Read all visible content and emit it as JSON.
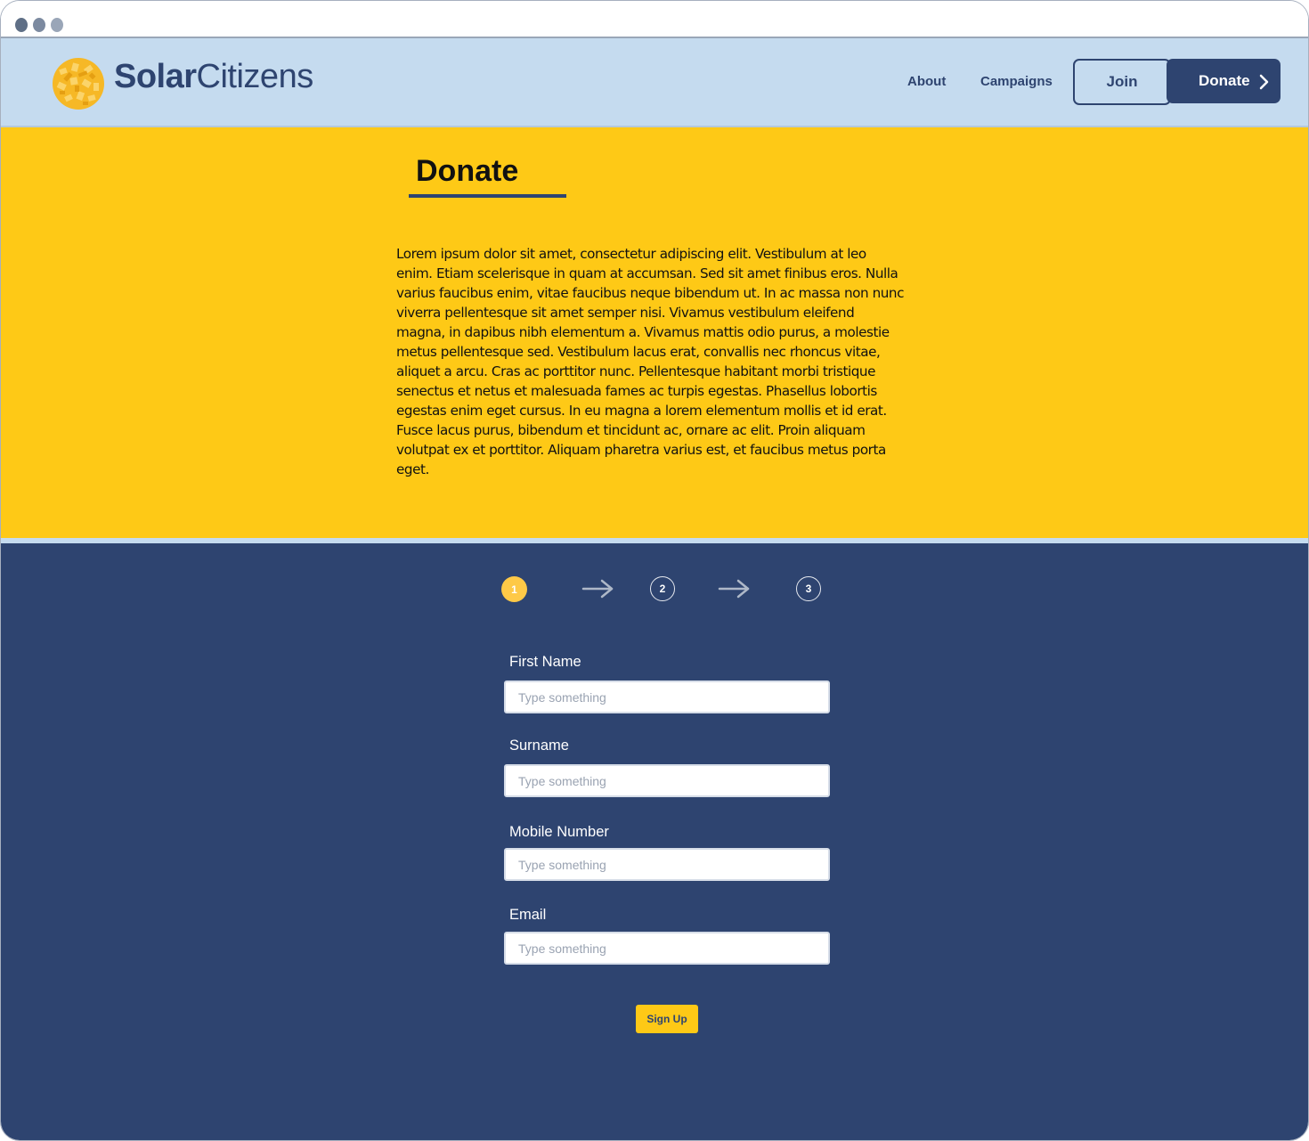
{
  "header": {
    "logo_bold": "Solar",
    "logo_light": "Citizens",
    "nav": {
      "about": "About",
      "campaigns": "Campaigns"
    },
    "join_label": "Join",
    "donate_label": "Donate"
  },
  "hero": {
    "title": "Donate",
    "body": "Lorem ipsum dolor sit amet, consectetur adipiscing elit. Vestibulum at leo enim. Etiam scelerisque in quam at accumsan. Sed sit amet finibus eros. Nulla varius faucibus enim, vitae faucibus neque bibendum ut. In ac massa non nunc viverra pellentesque sit amet semper nisi. Vivamus vestibulum eleifend magna, in dapibus nibh elementum a. Vivamus mattis odio purus, a molestie metus pellentesque sed. Vestibulum lacus erat, convallis nec rhoncus vitae, aliquet a arcu. Cras ac porttitor nunc. Pellentesque habitant morbi tristique senectus et netus et malesuada fames ac turpis egestas. Phasellus lobortis egestas enim eget cursus. In eu magna a lorem elementum mollis et id erat. Fusce lacus purus, bibendum et tincidunt ac, ornare ac elit. Proin aliquam volutpat ex et porttitor. Aliquam pharetra varius est, et faucibus metus porta eget."
  },
  "steps": {
    "current": 1,
    "items": [
      "1",
      "2",
      "3"
    ]
  },
  "form": {
    "fields": [
      {
        "label": "First Name",
        "placeholder": "Type something",
        "value": ""
      },
      {
        "label": "Surname",
        "placeholder": "Type something",
        "value": ""
      },
      {
        "label": "Mobile Number",
        "placeholder": "Type something",
        "value": ""
      },
      {
        "label": "Email",
        "placeholder": "Type something",
        "value": ""
      }
    ],
    "submit_label": "Sign Up"
  },
  "colors": {
    "navy": "#2e4470",
    "yellow": "#fec916",
    "light_blue": "#c5dbef"
  },
  "icons": {
    "logo": "solar-globe-icon",
    "donate_chevron": "chevron-right-icon",
    "step_arrow": "arrow-right-icon"
  }
}
